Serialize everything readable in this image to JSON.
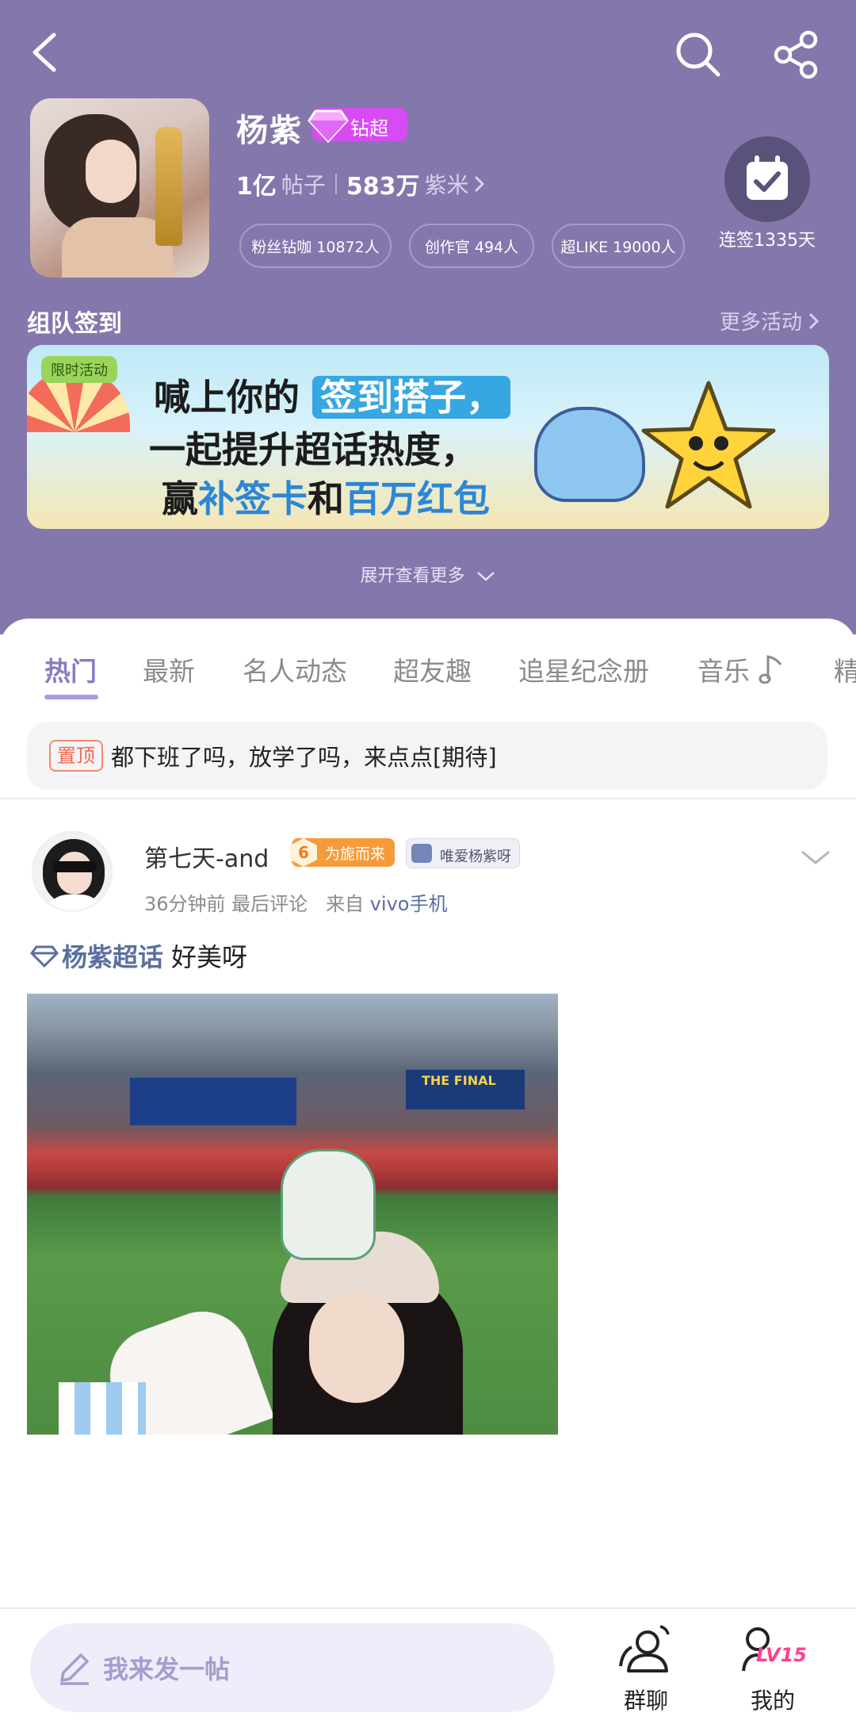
{
  "header": {
    "name": "杨紫",
    "badge": "钻超",
    "stats": {
      "posts_value": "1亿",
      "posts_label": "帖子",
      "fans_value": "583万",
      "fans_label": "紫米"
    },
    "chips": [
      "粉丝钻咖 10872人",
      "创作官 494人",
      "超LIKE 19000人"
    ],
    "checkin_label": "连签1335天"
  },
  "team_checkin": {
    "title": "组队签到",
    "more": "更多活动"
  },
  "banner": {
    "tag": "限时活动",
    "line1_prefix": "喊上你的",
    "line1_highlight": "签到搭子，",
    "line2": "一起提升超话热度，",
    "line3_a": "赢",
    "line3_b": "补签卡",
    "line3_c": "和",
    "line3_d": "百万红包"
  },
  "expand": "展开查看更多",
  "tabs": [
    "热门",
    "最新",
    "名人动态",
    "超友趣",
    "追星纪念册",
    "音乐",
    "精"
  ],
  "pinned": {
    "tag": "置顶",
    "text": "都下班了吗，放学了吗，来点点[期待]"
  },
  "post": {
    "username": "第七天-and",
    "fan_level": "6",
    "fan_badge": "为旎而来",
    "love_badge": "唯爱杨紫呀",
    "time": "36分钟前 最后评论",
    "source_prefix": "来自",
    "source": "vivo手机",
    "topic": "杨紫超话",
    "text": "好美呀",
    "image_caption": "THE FINAL"
  },
  "bottom": {
    "compose_placeholder": "我来发一帖",
    "group_chat": "群聊",
    "mine": "我的",
    "level": "LV15"
  },
  "colors": {
    "header_bg": "#8477ac",
    "accent": "#8a7cc3",
    "badge": "#d64cf2"
  }
}
